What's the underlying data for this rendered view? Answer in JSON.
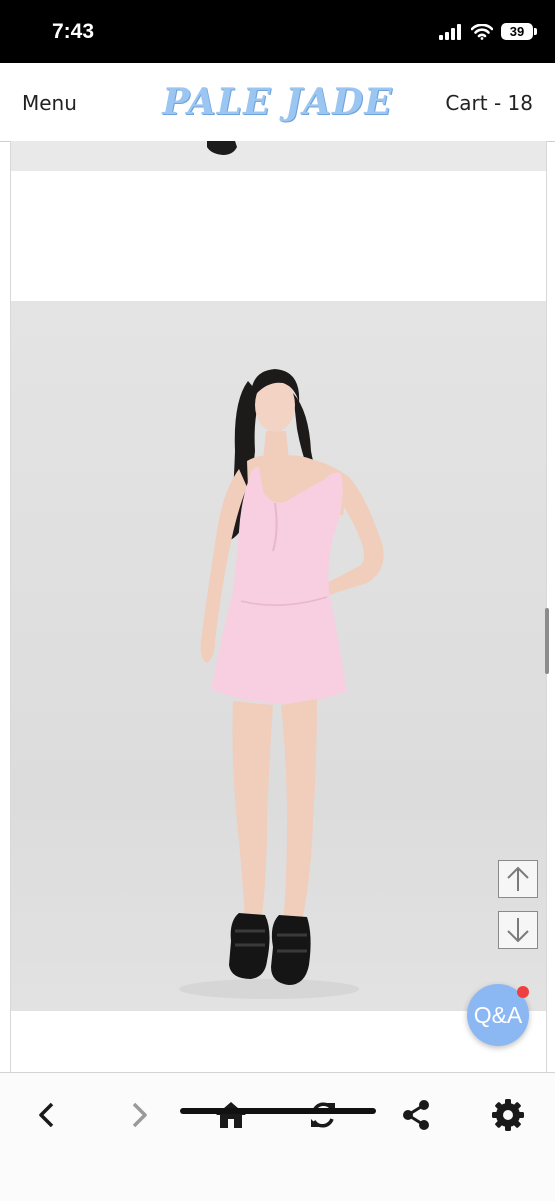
{
  "status_bar": {
    "time": "7:43",
    "battery": "39"
  },
  "header": {
    "menu_label": "Menu",
    "brand": "PALE JADE",
    "cart_label": "Cart - 18"
  },
  "floating": {
    "qa_label": "Q&A"
  },
  "colors": {
    "brand": "#9cc6f2",
    "qa_button": "#8bb8f3",
    "dress": "#f7cfe0",
    "notification_dot": "#ef4040"
  },
  "icons": {
    "status": [
      "signal-icon",
      "wifi-icon",
      "battery-icon"
    ],
    "scroll": [
      "arrow-up-icon",
      "arrow-down-icon"
    ],
    "bottom_bar": [
      "back-icon",
      "forward-icon",
      "home-icon",
      "refresh-icon",
      "share-icon",
      "settings-icon"
    ]
  }
}
